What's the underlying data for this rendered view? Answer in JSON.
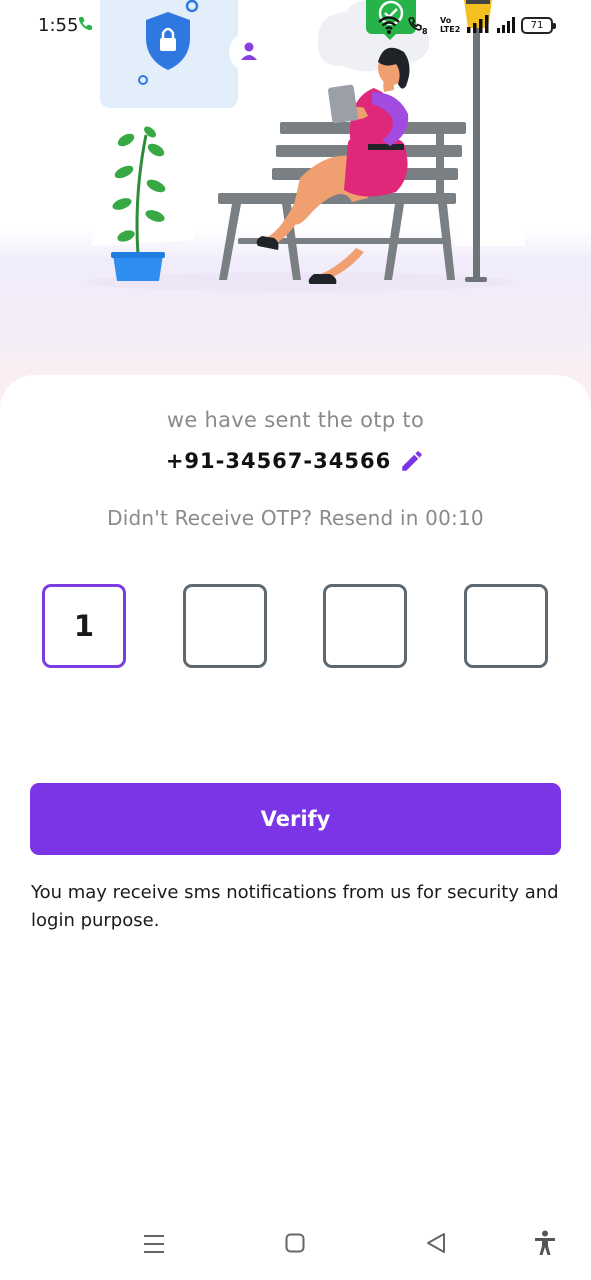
{
  "status_bar": {
    "time": "1:55",
    "volte_line1": "Vo",
    "volte_line2": "LTE2",
    "battery": "71",
    "icons": [
      "call-icon",
      "wifi-icon",
      "wifi-calling-icon",
      "volte-icon",
      "signal-icon",
      "signal-icon",
      "battery-icon"
    ]
  },
  "otp": {
    "sent_label": "we have sent the otp to",
    "phone": "+91-34567-34566",
    "resend_text": "Didn't Receive OTP? Resend in 00:10",
    "digits": [
      "1",
      "",
      "",
      ""
    ],
    "active_index": 0
  },
  "verify_label": "Verify",
  "notice": "You may receive sms notifications from us for security and login purpose.",
  "nav_icons": [
    "menu-icon",
    "home-icon",
    "back-icon",
    "accessibility-icon"
  ],
  "colors": {
    "accent": "#7b34e6",
    "active_border": "#7c3cdf",
    "box_border": "#5e6870",
    "muted_text": "#8a8a8a",
    "edit_icon": "#7b34e6",
    "hero_bg": "#f1ecfb"
  }
}
